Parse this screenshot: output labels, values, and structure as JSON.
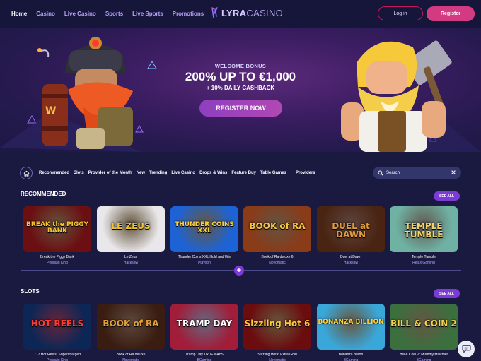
{
  "nav": {
    "links": [
      "Home",
      "Casino",
      "Live Casino",
      "Sports",
      "Live Sports",
      "Promotions"
    ],
    "active": "Home",
    "logo_primary": "LYRA",
    "logo_secondary": "CASINO",
    "login_label": "Log in",
    "register_label": "Register"
  },
  "hero": {
    "eyebrow": "WELCOME BONUS",
    "title": "200% UP TO €1,000",
    "subtitle": "+ 10% DAILY CASHBACK",
    "cta_label": "REGISTER NOW"
  },
  "categories": {
    "items": [
      "Recommended",
      "Slots",
      "Provider of the Month",
      "New",
      "Trending",
      "Live Casino",
      "Drops & Wins",
      "Feature Buy",
      "Table Games"
    ],
    "after_divider": "Providers",
    "search_placeholder": "Search"
  },
  "recommended": {
    "title": "RECOMMENDED",
    "see_all": "SEE ALL",
    "games": [
      {
        "name": "Break the Piggy Bank",
        "provider": "Penguin King",
        "art": "BREAK the PIGGY BANK",
        "bg": "#6b0f12",
        "accent": "#f8c530"
      },
      {
        "name": "Le Zeus",
        "provider": "Hacksaw",
        "art": "LE ZEUS",
        "bg": "#e9e7ea",
        "accent": "#f2c52e"
      },
      {
        "name": "Thunder Coins XXL Hold and Win",
        "provider": "Playson",
        "art": "THUNDER COINS XXL",
        "bg": "#1d63d6",
        "accent": "#ffd23d"
      },
      {
        "name": "Book of Ra deluxe 6",
        "provider": "Novomatic",
        "art": "BOOK of RA",
        "bg": "#8a3b18",
        "accent": "#f5c542"
      },
      {
        "name": "Duel at Dawn",
        "provider": "Hacksaw",
        "art": "DUEL at DAWN",
        "bg": "#4a2412",
        "accent": "#e29a3a"
      },
      {
        "name": "Temple Tumble",
        "provider": "Relax Gaming",
        "art": "TEMPLE TUMBLE",
        "bg": "#6fb2a4",
        "accent": "#f5d36b"
      }
    ]
  },
  "slots": {
    "title": "SLOTS",
    "see_all": "SEE ALL",
    "games": [
      {
        "name": "777 Hot Reels: Supercharged",
        "provider": "Penguin King",
        "art": "HOT REELS",
        "bg": "#0c2656",
        "accent": "#ff3b30"
      },
      {
        "name": "Book of Ra deluxe",
        "provider": "Novomatic",
        "art": "BOOK of RA",
        "bg": "#3a1d10",
        "accent": "#e3a13a"
      },
      {
        "name": "Tramp Day TRUEWAYS",
        "provider": "BGaming",
        "art": "TRAMP DAY",
        "bg": "#a11d3a",
        "accent": "#ffffff"
      },
      {
        "name": "Sizzling Hot 6 Extra Gold",
        "provider": "Novomatic",
        "art": "Sizzling Hot 6",
        "bg": "#6b0c0f",
        "accent": "#ffcc33"
      },
      {
        "name": "Bonanza Billion",
        "provider": "BGaming",
        "art": "BONANZA BILLION",
        "bg": "#3aa7d9",
        "accent": "#ffd23d"
      },
      {
        "name": "Bill & Coin 2: Mummy Mischief",
        "provider": "BGaming",
        "art": "BILL & COIN 2",
        "bg": "#3b6f3e",
        "accent": "#f6d14a"
      }
    ]
  },
  "colors": {
    "page_bg": "#1a1a40",
    "nav_bg": "#15163a",
    "accent_pink": "#d23a82",
    "accent_purple": "#7c3ad6",
    "provider_text": "#b0a3ff"
  },
  "icons": [
    "lyra-logo-icon",
    "home-icon",
    "search-icon",
    "close-icon",
    "plus-icon",
    "chat-icon"
  ]
}
